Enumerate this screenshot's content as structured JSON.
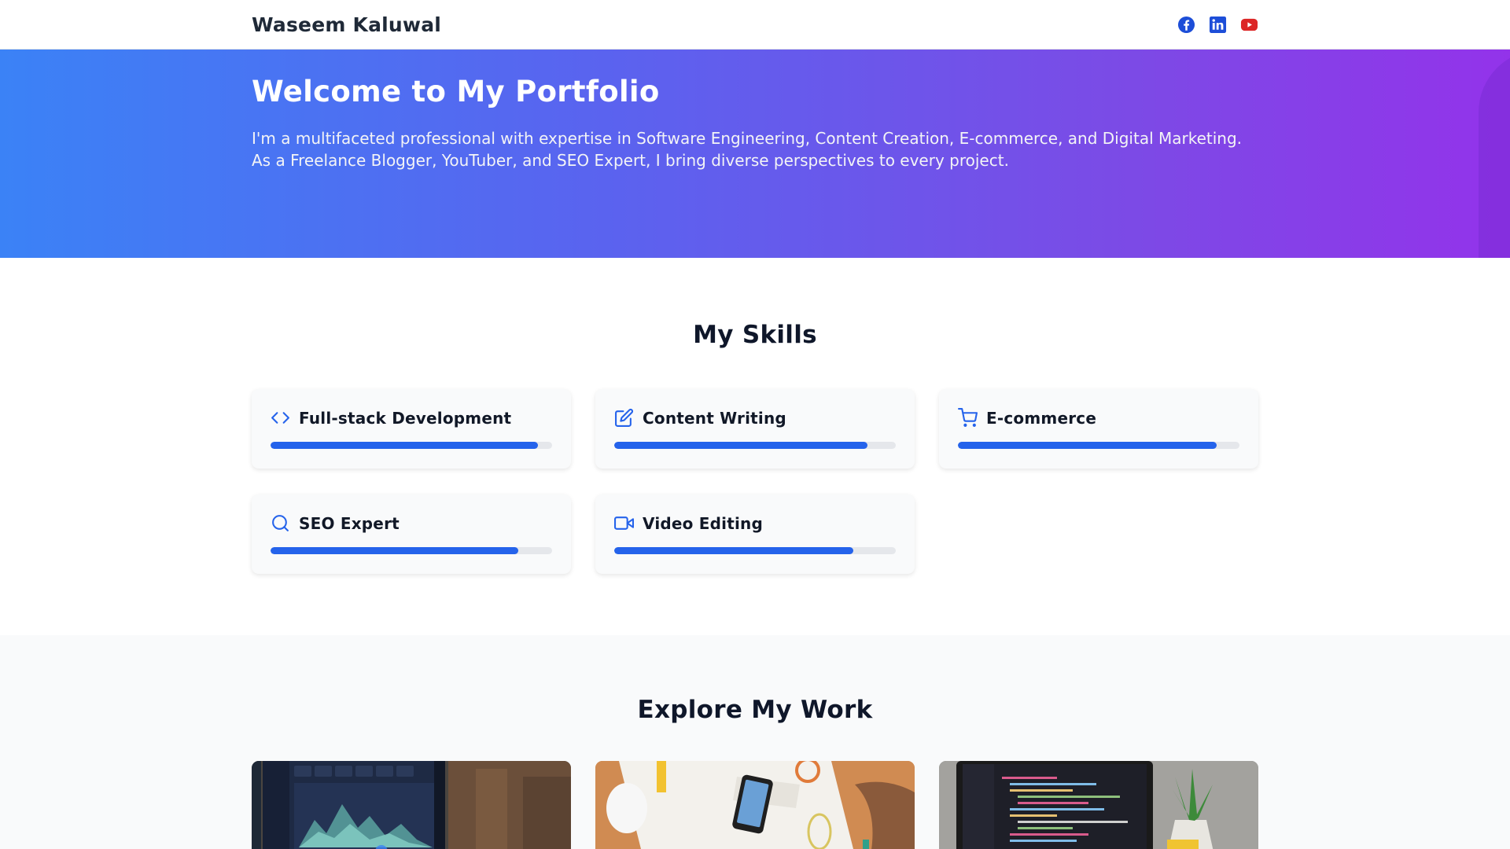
{
  "header": {
    "brand": "Waseem Kaluwal",
    "socials": [
      {
        "icon": "facebook-icon",
        "color": "#1d4ed8"
      },
      {
        "icon": "linkedin-icon",
        "color": "#1d4ed8"
      },
      {
        "icon": "youtube-icon",
        "color": "#dc2626"
      }
    ]
  },
  "hero": {
    "title": "Welcome to My Portfolio",
    "text_line1": "I'm a multifaceted professional with expertise in Software Engineering, Content Creation, E-commerce, and Digital Marketing.",
    "text_line2": "As a Freelance Blogger, YouTuber, and SEO Expert, I bring diverse perspectives to every project.",
    "gradient": [
      "#3b82f6",
      "#9333ea"
    ]
  },
  "skills": {
    "title": "My Skills",
    "accent": "#2563eb",
    "items": [
      {
        "name": "Full-stack Development",
        "icon": "code-icon",
        "level": 95
      },
      {
        "name": "Content Writing",
        "icon": "edit-icon",
        "level": 90
      },
      {
        "name": "E-commerce",
        "icon": "cart-icon",
        "level": 92
      },
      {
        "name": "SEO Expert",
        "icon": "search-icon",
        "level": 88
      },
      {
        "name": "Video Editing",
        "icon": "video-icon",
        "level": 85
      }
    ]
  },
  "work": {
    "title": "Explore My Work",
    "cards": [
      {
        "image": "analytics-dashboard-laptop-image"
      },
      {
        "image": "design-desk-phone-image"
      },
      {
        "image": "code-editor-laptop-image"
      }
    ]
  }
}
